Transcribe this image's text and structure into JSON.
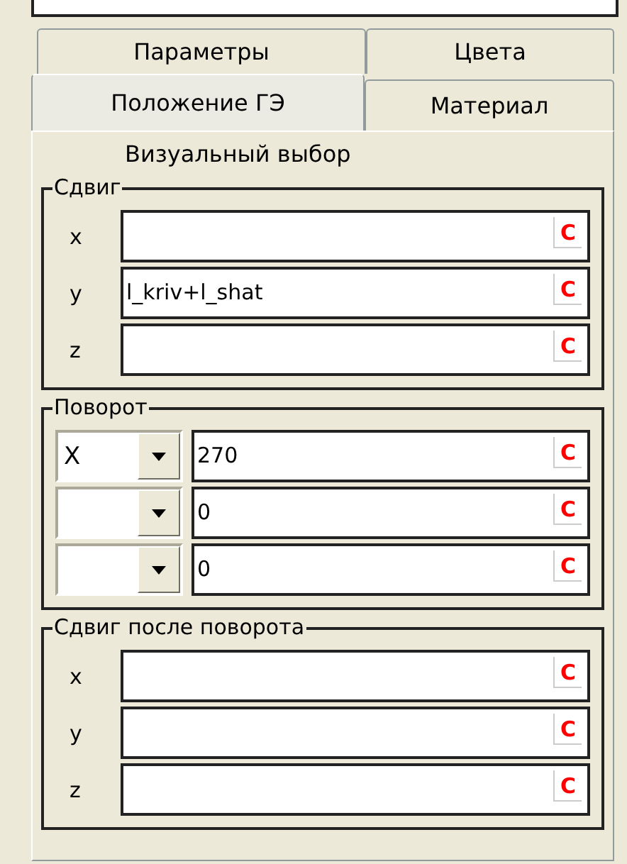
{
  "tab_rows": [
    [
      {
        "label": "Параметры",
        "selected": false
      },
      {
        "label": "Цвета",
        "selected": false
      }
    ],
    [
      {
        "label": "Положение ГЭ",
        "selected": true
      },
      {
        "label": "Материал",
        "selected": false
      }
    ]
  ],
  "visual_choice": "Визуальный выбор",
  "groups": [
    {
      "title": "Сдвиг",
      "kind": "axes",
      "rows": [
        {
          "label": "x",
          "button": "C"
        },
        {
          "label": "y",
          "value": "l_kriv+l_shat",
          "button": "C"
        },
        {
          "label": "z",
          "button": "C"
        }
      ]
    },
    {
      "title": "Поворот",
      "kind": "rotation",
      "rows": [
        {
          "axis": "X",
          "value": "270",
          "button": "C"
        },
        {
          "value": "0",
          "button": "C"
        },
        {
          "value": "0",
          "button": "C"
        }
      ]
    },
    {
      "title": "Сдвиг после поворота",
      "kind": "axes",
      "rows": [
        {
          "label": "x",
          "button": "C"
        },
        {
          "label": "y",
          "button": "C"
        },
        {
          "label": "z",
          "button": "C"
        }
      ]
    }
  ]
}
